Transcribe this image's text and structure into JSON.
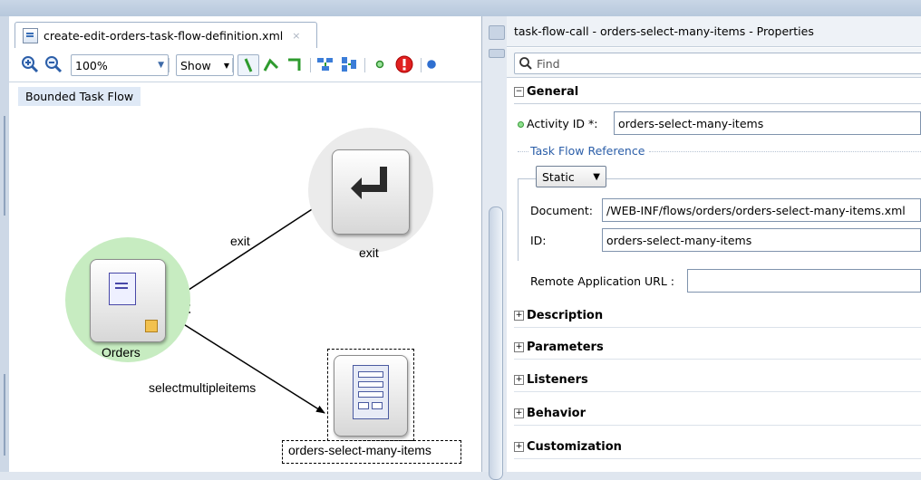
{
  "editor": {
    "tab_label": "create-edit-orders-task-flow-definition.xml",
    "tab_close": "×",
    "zoom_value": "100%",
    "show_label": "Show",
    "bounded_label": "Bounded Task Flow",
    "nodes": {
      "orders_label": "Orders",
      "exit_label": "exit",
      "select_label": "orders-select-many-items"
    },
    "edges": {
      "exit_label": "exit",
      "select_label": "selectmultipleitems"
    }
  },
  "properties": {
    "title": "task-flow-call - orders-select-many-items - Properties",
    "find_placeholder": "Find",
    "general_label": "General",
    "activity_id_label": "Activity ID *:",
    "activity_id_value": "orders-select-many-items",
    "task_flow_ref_label": "Task Flow Reference",
    "static_value": "Static",
    "document_label": "Document:",
    "document_value": "/WEB-INF/flows/orders/orders-select-many-items.xml",
    "id_label": "ID:",
    "id_value": "orders-select-many-items",
    "remote_url_label": "Remote Application URL :",
    "remote_url_value": "",
    "sections": {
      "description": "Description",
      "parameters": "Parameters",
      "listeners": "Listeners",
      "behavior": "Behavior",
      "customization": "Customization"
    }
  },
  "colors": {
    "orders_halo": "#c7ecc1",
    "grey_halo": "#ebebeb",
    "required_dot": "#3a9a3a"
  }
}
